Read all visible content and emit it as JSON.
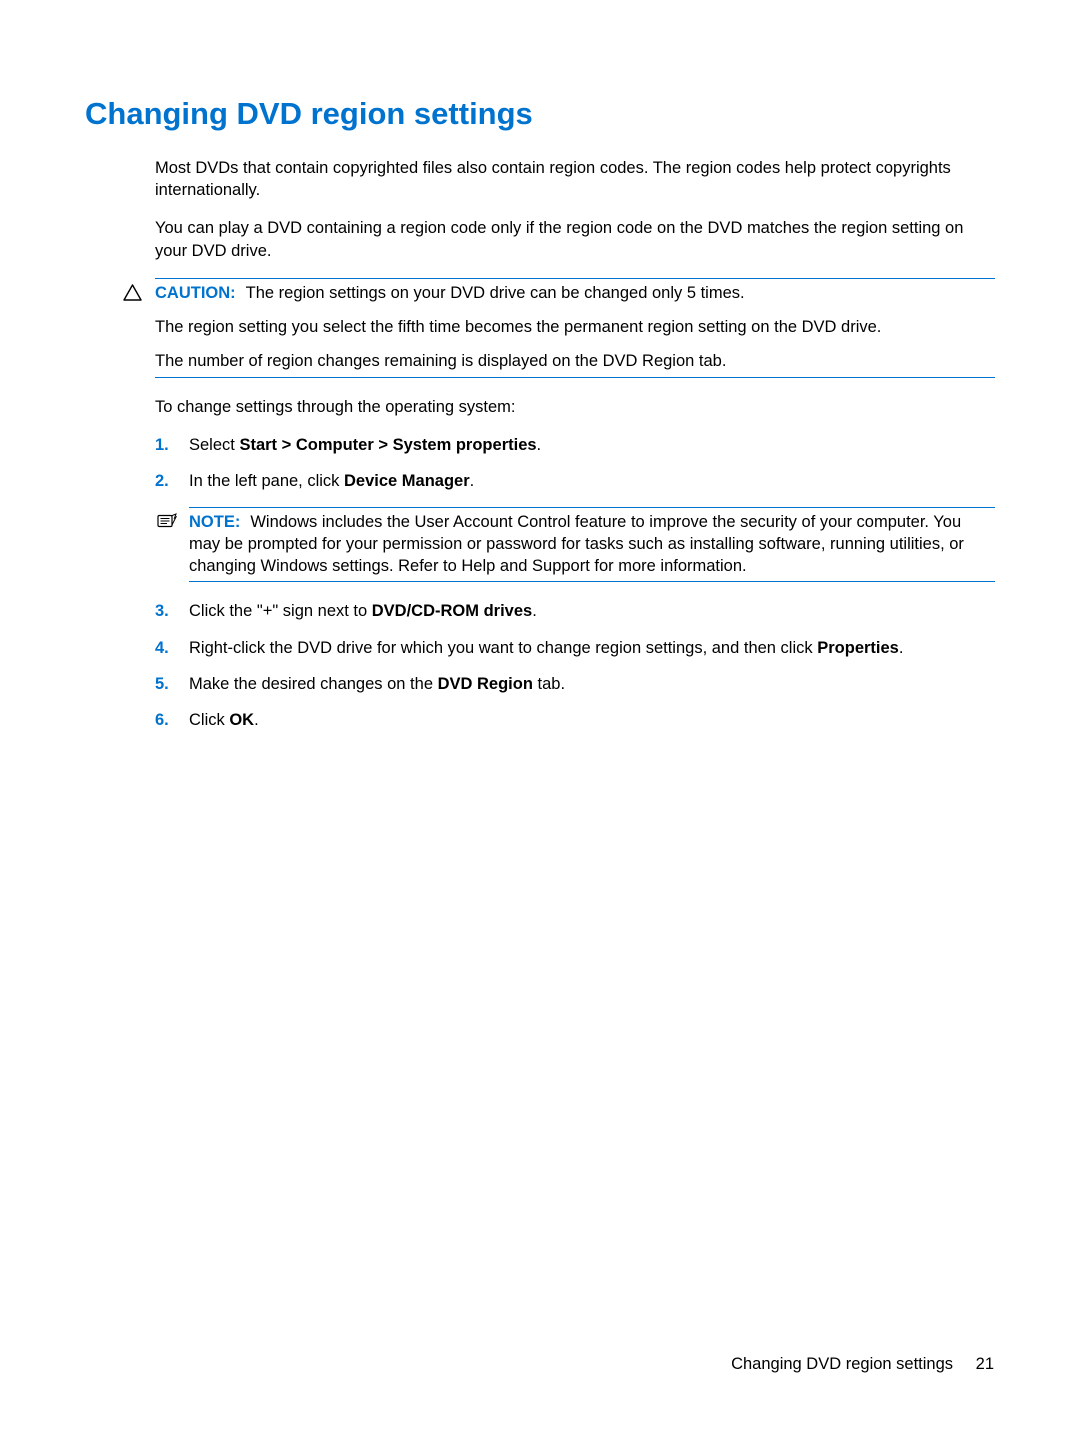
{
  "heading": "Changing DVD region settings",
  "intro1": "Most DVDs that contain copyrighted files also contain region codes. The region codes help protect copyrights internationally.",
  "intro2": "You can play a DVD containing a region code only if the region code on the DVD matches the region setting on your DVD drive.",
  "caution": {
    "label": "CAUTION:",
    "line1": "The region settings on your DVD drive can be changed only 5 times.",
    "line2": "The region setting you select the fifth time becomes the permanent region setting on the DVD drive.",
    "line3": "The number of region changes remaining is displayed on the DVD Region tab."
  },
  "leadIn": "To change settings through the operating system:",
  "steps": {
    "s1": {
      "num": "1.",
      "pre": "Select ",
      "bold": "Start > Computer > System properties",
      "post": "."
    },
    "s2": {
      "num": "2.",
      "pre": "In the left pane, click ",
      "bold": "Device Manager",
      "post": "."
    },
    "s3": {
      "num": "3.",
      "pre": "Click the \"+\" sign next to ",
      "bold": "DVD/CD-ROM drives",
      "post": "."
    },
    "s4": {
      "num": "4.",
      "pre": "Right-click the DVD drive for which you want to change region settings, and then click ",
      "bold": "Properties",
      "post": "."
    },
    "s5": {
      "num": "5.",
      "pre": "Make the desired changes on the ",
      "bold": "DVD Region",
      "post": " tab."
    },
    "s6": {
      "num": "6.",
      "pre": "Click ",
      "bold": "OK",
      "post": "."
    }
  },
  "note": {
    "label": "NOTE:",
    "text": "Windows includes the User Account Control feature to improve the security of your computer. You may be prompted for your permission or password for tasks such as installing software, running utilities, or changing Windows settings. Refer to Help and Support for more information."
  },
  "footer": {
    "title": "Changing DVD region settings",
    "page": "21"
  }
}
